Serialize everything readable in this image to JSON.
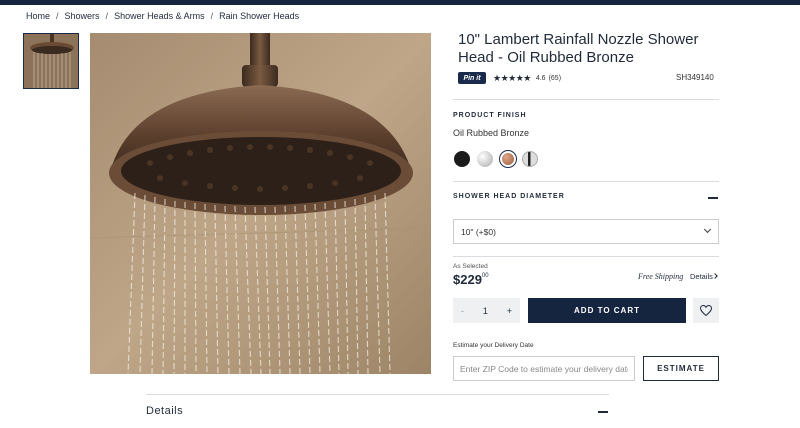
{
  "breadcrumb": [
    "Home",
    "Showers",
    "Shower Heads & Arms",
    "Rain Shower Heads"
  ],
  "product": {
    "title": "10\" Lambert Rainfall Nozzle Shower Head - Oil Rubbed Bronze",
    "pin_label": "Pin it",
    "stars": "★★★★★",
    "rating": "4.6",
    "review_count": "(65)",
    "sku": "SH349140"
  },
  "finish": {
    "label": "PRODUCT FINISH",
    "value": "Oil Rubbed Bronze",
    "swatches": [
      {
        "name": "matte black",
        "color": "#1b1b1b"
      },
      {
        "name": "chrome",
        "color": "#c8c8c8"
      },
      {
        "name": "oil rubbed bronze",
        "color": "#b06b4f",
        "selected": true
      },
      {
        "name": "polished nickel",
        "color": "#9a9a9a"
      }
    ]
  },
  "diameter": {
    "label": "SHOWER HEAD DIAMETER",
    "selected_option": "10\" (+$0)"
  },
  "pricing": {
    "as_selected_label": "As Selected",
    "price_main": "$229",
    "price_cents": "00",
    "free_shipping": "Free Shipping",
    "details_link": "Details"
  },
  "cart": {
    "minus": "-",
    "quantity": "1",
    "plus": "+",
    "add_to_cart": "ADD TO CART"
  },
  "delivery": {
    "label": "Estimate your Delivery Date",
    "zip_placeholder": "Enter ZIP Code to estimate your delivery date",
    "estimate_button": "ESTIMATE"
  },
  "sections": {
    "details": "Details"
  },
  "colors": {
    "navy": "#16253f",
    "bronze": "#6b4a33"
  }
}
